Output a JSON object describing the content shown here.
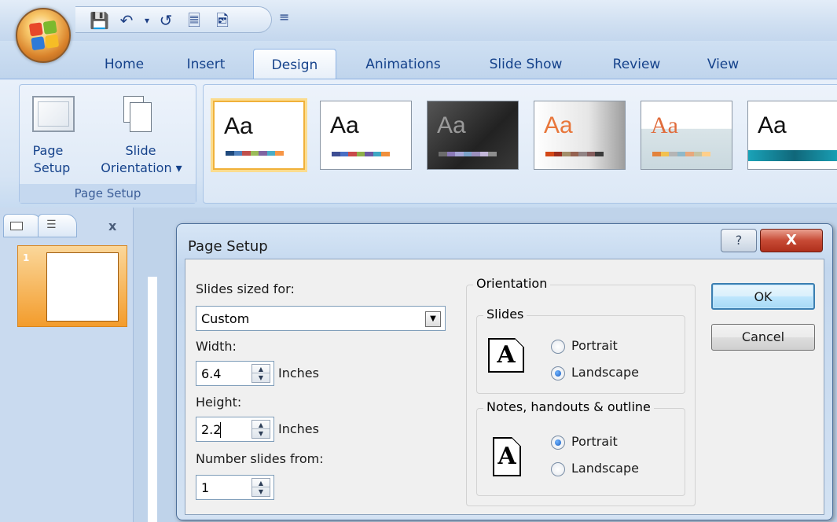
{
  "quick_access": {
    "icons": [
      "save-icon",
      "undo-icon",
      "dropdown-arrow-icon",
      "redo-icon",
      "new-icon",
      "print-preview-icon",
      "customize-icon"
    ]
  },
  "ribbon": {
    "tabs": [
      {
        "label": "Home"
      },
      {
        "label": "Insert"
      },
      {
        "label": "Design"
      },
      {
        "label": "Animations"
      },
      {
        "label": "Slide Show"
      },
      {
        "label": "Review"
      },
      {
        "label": "View"
      }
    ],
    "active_tab": "Design",
    "page_setup_group": {
      "page_setup_label_1": "Page",
      "page_setup_label_2": "Setup",
      "orientation_label_1": "Slide",
      "orientation_label_2": "Orientation ▾",
      "caption": "Page Setup"
    },
    "themes": [
      {
        "text": "Aa",
        "bg": "#ffffff",
        "text_color": "#111111",
        "selected": true
      },
      {
        "text": "Aa",
        "bg": "#ffffff",
        "text_color": "#111111",
        "selected": false
      },
      {
        "text": "Aa",
        "bg": "#3a3a3a",
        "text_color": "#9a9a9a",
        "selected": false
      },
      {
        "text": "Aa",
        "bg": "#efefef",
        "text_color": "#e8763a",
        "selected": false
      },
      {
        "text": "Aa",
        "bg": "#dfe7ea",
        "text_color": "#e06c3c",
        "selected": false
      },
      {
        "text": "Aa",
        "bg": "#ffffff",
        "text_color": "#111111",
        "selected": false
      }
    ]
  },
  "slides_pane": {
    "close_label": "x",
    "thumbnail_number": "1"
  },
  "dialog": {
    "title": "Page Setup",
    "help_label": "?",
    "close_label": "X",
    "slides_sized_for_label": "Slides sized for:",
    "slides_sized_for_value": "Custom",
    "width_label": "Width:",
    "width_value": "6.4",
    "width_unit": "Inches",
    "height_label": "Height:",
    "height_value": "2.2",
    "height_unit": "Inches",
    "number_from_label": "Number slides from:",
    "number_from_value": "1",
    "orientation_label": "Orientation",
    "slides_group_label": "Slides",
    "slides_portrait_label": "Portrait",
    "slides_landscape_label": "Landscape",
    "slides_selected": "Landscape",
    "notes_group_label": "Notes, handouts & outline",
    "notes_portrait_label": "Portrait",
    "notes_landscape_label": "Landscape",
    "notes_selected": "Portrait",
    "page_icon_letter": "A",
    "ok_label": "OK",
    "cancel_label": "Cancel"
  }
}
